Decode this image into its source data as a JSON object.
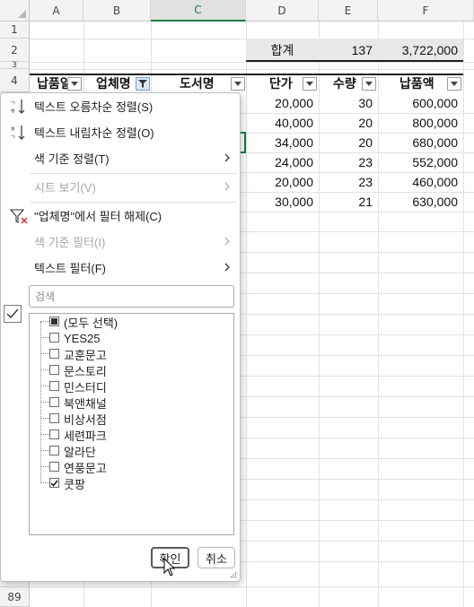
{
  "columns": [
    "A",
    "B",
    "C",
    "D",
    "E",
    "F"
  ],
  "rows": [
    "1",
    "2",
    "3",
    "4",
    "89"
  ],
  "summary": {
    "label": "합계",
    "qty": "137",
    "amount": "3,722,000"
  },
  "headers": {
    "a": "납품일",
    "b": "업체명",
    "c": "도서명",
    "d": "단가",
    "e": "수량",
    "f": "납품액"
  },
  "data_rows": [
    {
      "price": "20,000",
      "qty": "30",
      "amount": "600,000"
    },
    {
      "price": "40,000",
      "qty": "20",
      "amount": "800,000"
    },
    {
      "price": "34,000",
      "qty": "20",
      "amount": "680,000"
    },
    {
      "price": "24,000",
      "qty": "23",
      "amount": "552,000"
    },
    {
      "price": "20,000",
      "qty": "23",
      "amount": "460,000"
    },
    {
      "price": "30,000",
      "qty": "21",
      "amount": "630,000"
    }
  ],
  "menu": {
    "sort_asc": "텍스트 오름차순 정렬(S)",
    "sort_desc": "텍스트 내림차순 정렬(O)",
    "sort_color": "색 기준 정렬(T)",
    "sheet_view": "시트 보기(V)",
    "clear_filter": "\"업체명\"에서 필터 해제(C)",
    "filter_color": "색 기준 필터(I)",
    "text_filter": "텍스트 필터(F)"
  },
  "search": {
    "placeholder": "검색"
  },
  "list_items": [
    {
      "label": "(모두 선택)",
      "state": "partial"
    },
    {
      "label": "YES25",
      "state": "unchecked"
    },
    {
      "label": "교훈문고",
      "state": "unchecked"
    },
    {
      "label": "문스토리",
      "state": "unchecked"
    },
    {
      "label": "민스터디",
      "state": "unchecked"
    },
    {
      "label": "북앤채널",
      "state": "unchecked"
    },
    {
      "label": "비상서점",
      "state": "unchecked"
    },
    {
      "label": "세련파크",
      "state": "unchecked"
    },
    {
      "label": "알라단",
      "state": "unchecked"
    },
    {
      "label": "연풍문고",
      "state": "unchecked"
    },
    {
      "label": "쿳팡",
      "state": "checked"
    }
  ],
  "buttons": {
    "ok": "확인",
    "cancel": "취소"
  },
  "colors": {
    "accent_green": "#137e43",
    "filter_active": "#dbe8f6"
  }
}
